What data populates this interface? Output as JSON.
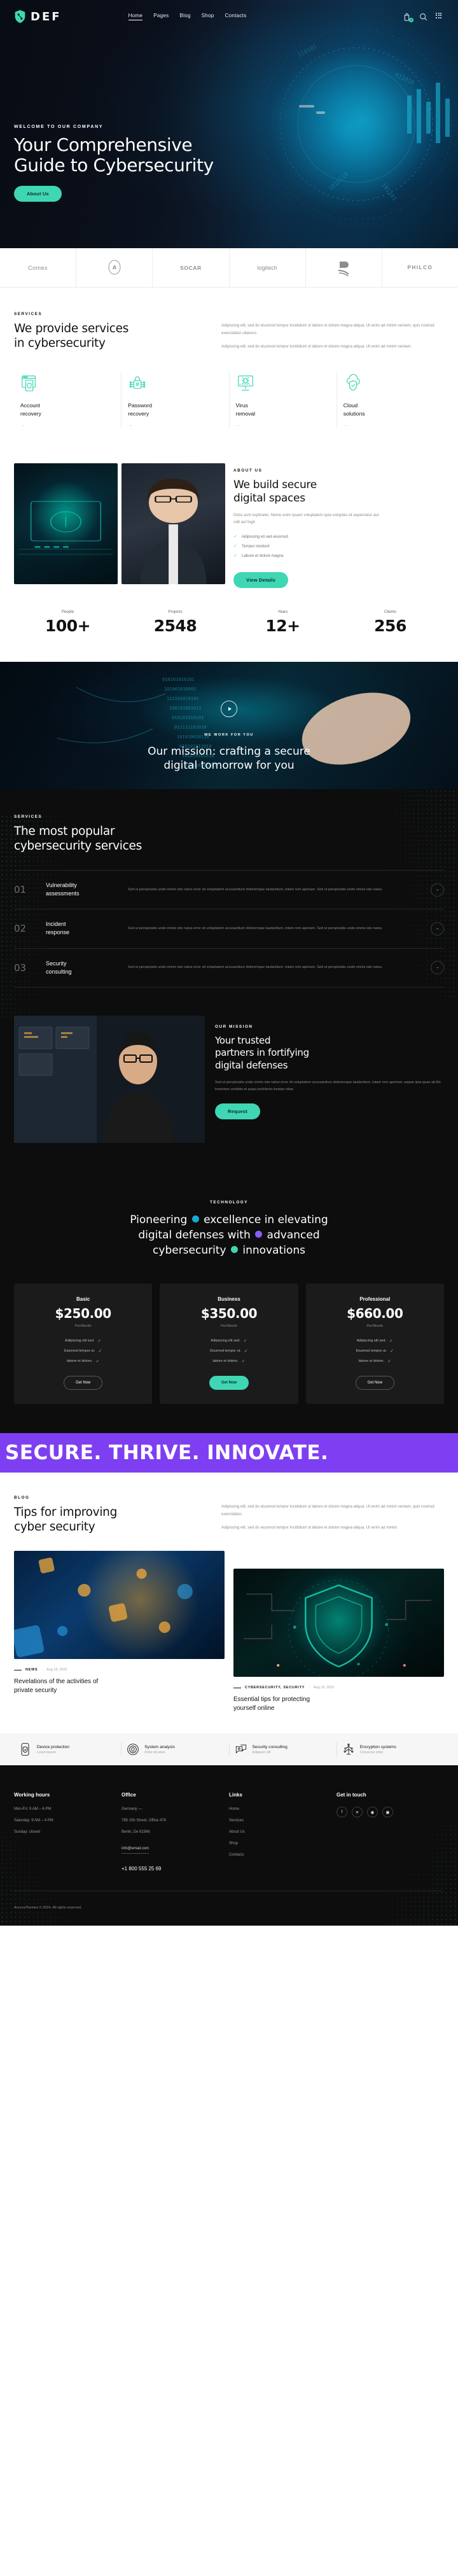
{
  "brand": {
    "name": "DEF",
    "logo_icon": "shield-lock-icon"
  },
  "nav": {
    "items": [
      {
        "label": "Home",
        "active": true
      },
      {
        "label": "Pages",
        "active": false
      },
      {
        "label": "Blog",
        "active": false
      },
      {
        "label": "Shop",
        "active": false
      },
      {
        "label": "Contacts",
        "active": false
      }
    ],
    "icons": [
      {
        "name": "cart-icon",
        "badge": "0"
      },
      {
        "name": "search-icon"
      },
      {
        "name": "grid-menu-icon"
      }
    ]
  },
  "hero": {
    "eyebrow": "WELCOME TO OUR COMPANY",
    "title_line1": "Your Comprehensive",
    "title_line2": "Guide to Cybersecurity",
    "cta": "About Us"
  },
  "logos": [
    {
      "name": "Comex",
      "style": "text"
    },
    {
      "name": "ASTM",
      "style": "mark"
    },
    {
      "name": "SOCAR",
      "style": "socar"
    },
    {
      "name": "logitech",
      "style": "logitech"
    },
    {
      "name": "B",
      "style": "mark"
    },
    {
      "name": "PHILCO",
      "style": "philco"
    }
  ],
  "services": {
    "kicker": "SERVICES",
    "title_line1": "We provide services",
    "title_line2": "in cybersecurity",
    "para1": "Adipiscing elit, sed do eiusmod tempor incididunt ut labore et dolore magna aliqua. Ut enim ad minim veniam, quis nostrud exercitation ullamco.",
    "para2": "Adipiscing elit, sed do eiusmod tempor incididunt ut labore et dolore magna aliqua. Ut enim ad minim veniam.",
    "cards": [
      {
        "icon": "account-recovery-icon",
        "title_line1": "Account",
        "title_line2": "recovery",
        "arrow": "→"
      },
      {
        "icon": "password-lock-icon",
        "title_line1": "Password",
        "title_line2": "recovery",
        "arrow": "→"
      },
      {
        "icon": "virus-monitor-icon",
        "title_line1": "Virus",
        "title_line2": "removal",
        "arrow": "→"
      },
      {
        "icon": "cloud-shield-icon",
        "title_line1": "Cloud",
        "title_line2": "solutions",
        "arrow": "→"
      }
    ]
  },
  "about": {
    "kicker": "ABOUT US",
    "title_line1": "We build secure",
    "title_line2": "digital spaces",
    "lead": "Dicta sunt explicabo. Nemo enim ipsam voluptatem quia voluptas sit aspernatur aut odit aut fugit.",
    "checks": [
      "Adipiscing eli sed eiusmod",
      "Tempor incidunt",
      "Labore et dolore magna"
    ],
    "cta": "View Details"
  },
  "stats": [
    {
      "label": "People",
      "value": "100+"
    },
    {
      "label": "Projects",
      "value": "2548"
    },
    {
      "label": "Years",
      "value": "12+"
    },
    {
      "label": "Clients",
      "value": "256"
    }
  ],
  "mission": {
    "kicker": "WE WORK FOR YOU",
    "title_line1": "Our mission: crafting a secure",
    "title_line2": "digital tomorrow for you",
    "play_icon": "play-icon"
  },
  "popular": {
    "kicker": "SERVICES",
    "title_line1": "The most popular",
    "title_line2": "cybersecurity services",
    "rows": [
      {
        "num": "01",
        "title_line1": "Vulnerability",
        "title_line2": "assessments",
        "desc": "Sed ut perspiciatis unde omnis iste natus error sit voluptatem accusantium doloremque laudantium, totam rem aperiam. Sed ut perspiciatis unde omnis iste natus.",
        "arrow": "→"
      },
      {
        "num": "02",
        "title_line1": "Incident",
        "title_line2": "response",
        "desc": "Sed ut perspiciatis unde omnis iste natus error sit voluptatem accusantium doloremque laudantium, totam rem aperiam. Sed ut perspiciatis unde omnis iste natus.",
        "arrow": "→"
      },
      {
        "num": "03",
        "title_line1": "Security",
        "title_line2": "consulting",
        "desc": "Sed ut perspiciatis unde omnis iste natus error sit voluptatem accusantium doloremque laudantium, totam rem aperiam. Sed ut perspiciatis unde omnis iste natus.",
        "arrow": "→"
      }
    ]
  },
  "partners": {
    "kicker": "OUR MISSION",
    "title_line1": "Your trusted",
    "title_line2": "partners in fortifying",
    "title_line3": "digital defenses",
    "desc": "Sed ut perspiciatis unde omnis iste natus error sit voluptatem accusantium doloremque laudantium, totam rem aperiam, eaque ipsa quae ab illo inventore veritatis et quasi architecto beatae vitae.",
    "cta": "Request"
  },
  "technology": {
    "kicker": "TECHNOLOGY",
    "word1": "Pioneering",
    "word2": "excellence in elevating",
    "word3": "digital defenses with",
    "word4": "advanced",
    "word5": "cybersecurity",
    "word6": "innovations",
    "dot1_color": "#1ba8d4",
    "dot2_color": "#8b5cf6",
    "dot3_color": "#3fd6b4"
  },
  "pricing": [
    {
      "label": "Basic",
      "value": "$250.00",
      "period": "Per/Month",
      "features": [
        "Adipiscing elit sed.",
        "Eiusmod tempor ut.",
        "labore et dolore."
      ],
      "cta": "Get Now",
      "featured": false
    },
    {
      "label": "Business",
      "value": "$350.00",
      "period": "Per/Month",
      "features": [
        "Adipiscing elit sed.",
        "Eiusmod tempor ut.",
        "labore et dolore."
      ],
      "cta": "Get Now",
      "featured": true
    },
    {
      "label": "Professional",
      "value": "$660.00",
      "period": "Per/Month",
      "features": [
        "Adipiscing elit sed.",
        "Eiusmod tempor ut.",
        "labore et dolore."
      ],
      "cta": "Get Now",
      "featured": false
    }
  ],
  "marquee": {
    "text": "SECURE. THRIVE. INNOVATE."
  },
  "blog": {
    "kicker": "BLOG",
    "title_line1": "Tips for improving",
    "title_line2": "cyber security",
    "para1": "Adipiscing elit, sed do eiusmod tempor incididunt ut labore et dolore magna aliqua. Ut enim ad minim veniam, quis nostrud exercitation.",
    "para2": "Adipiscing elit, sed do eiusmod tempor incididunt ut labore et dolore magna aliqua. Ut enim ad minim.",
    "posts": [
      {
        "category": "NEWS",
        "date": "Aug 18, 2023",
        "title_line1": "Revelations of the activities of",
        "title_line2": "private security"
      },
      {
        "category": "CYBERSECURITY, SECURITY",
        "date": "Aug 18, 2023",
        "title_line1": "Essential tips for protecting",
        "title_line2": "yourself online"
      }
    ]
  },
  "features": [
    {
      "icon": "device-protection-icon",
      "title": "Device protection",
      "sub": "Lorem ipsum"
    },
    {
      "icon": "fingerprint-icon",
      "title": "System analysis",
      "sub": "Dolor sit amet"
    },
    {
      "icon": "consulting-icon",
      "title": "Security consulting",
      "sub": "Adipiscin elit"
    },
    {
      "icon": "encryption-icon",
      "title": "Encryption systems",
      "sub": "Consectur dolor"
    }
  ],
  "footer": {
    "cols": [
      {
        "heading": "Working hours",
        "lines": [
          "Mon-Fri: 9 AM – 6 PM",
          "Saturday: 9 AM – 4 PM",
          "Sunday: closed"
        ]
      },
      {
        "heading": "Office",
        "lines": [
          "Germany —",
          "785 15h Street, Office 478",
          "Berlin, De 81566"
        ],
        "email": "info@email.com",
        "phone": "+1 800 555 25 69"
      },
      {
        "heading": "Links",
        "links": [
          "Home",
          "Services",
          "About Us",
          "Shop",
          "Contacts"
        ]
      },
      {
        "heading": "Get in touch",
        "socials": [
          {
            "name": "facebook-icon",
            "glyph": "f"
          },
          {
            "name": "twitter-x-icon",
            "glyph": "✕"
          },
          {
            "name": "dribbble-icon",
            "glyph": "◉"
          },
          {
            "name": "instagram-icon",
            "glyph": "▣"
          }
        ]
      }
    ],
    "copyright": "AncoraThemes © 2024. All rights reserved."
  }
}
